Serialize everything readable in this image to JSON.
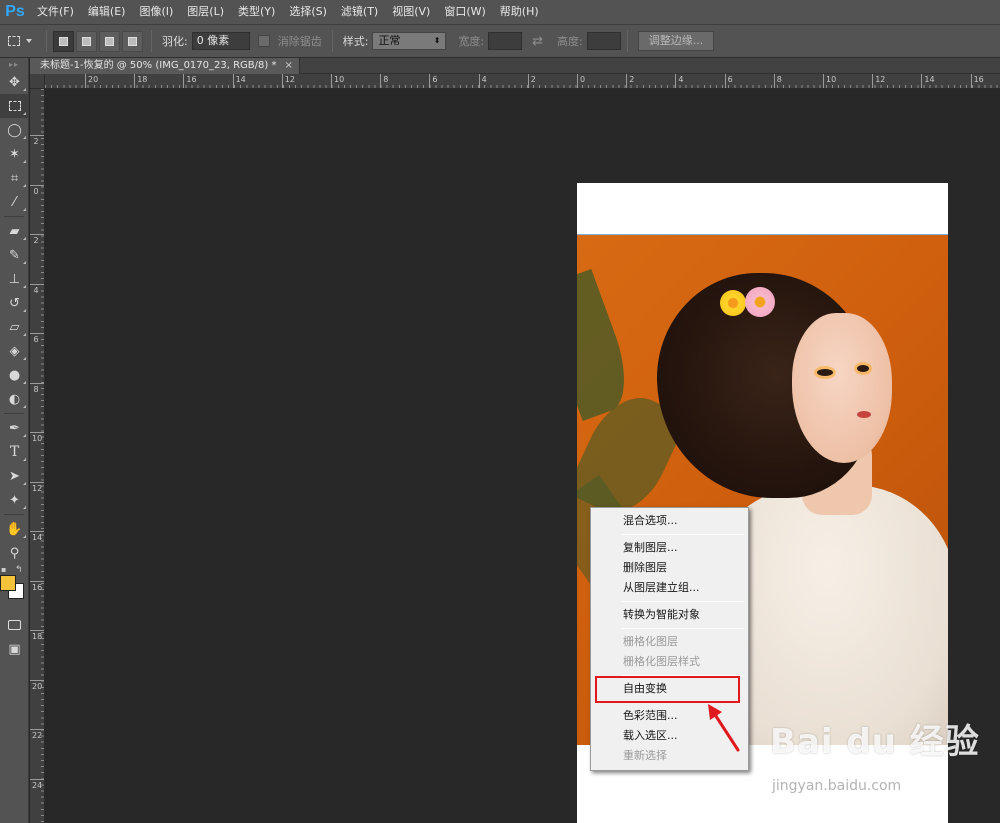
{
  "app": {
    "logo": "Ps"
  },
  "menu": [
    "文件(F)",
    "编辑(E)",
    "图像(I)",
    "图层(L)",
    "类型(Y)",
    "选择(S)",
    "滤镜(T)",
    "视图(V)",
    "窗口(W)",
    "帮助(H)"
  ],
  "options": {
    "feather_label": "羽化:",
    "feather_value": "0 像素",
    "antialias_label": "消除锯齿",
    "style_label": "样式:",
    "style_value": "正常",
    "width_label": "宽度:",
    "height_label": "高度:",
    "refine_button": "调整边缘..."
  },
  "document": {
    "tab_title": "未标题-1-恢复的 @ 50% (IMG_0170_23, RGB/8) *",
    "close": "×"
  },
  "rulers": {
    "horizontal": [
      "20",
      "18",
      "16",
      "14",
      "12",
      "10",
      "8",
      "6",
      "4",
      "2",
      "0",
      "2",
      "4",
      "6",
      "8",
      "10",
      "12",
      "14",
      "16"
    ],
    "vertical": [
      "2",
      "0",
      "2",
      "4",
      "6",
      "8",
      "10",
      "12",
      "14",
      "16",
      "18",
      "20",
      "22",
      "24"
    ]
  },
  "context_menu": [
    {
      "label": "混合选项...",
      "disabled": false
    },
    {
      "sep": true
    },
    {
      "label": "复制图层...",
      "disabled": false
    },
    {
      "label": "删除图层",
      "disabled": false
    },
    {
      "label": "从图层建立组...",
      "disabled": false
    },
    {
      "sep": true
    },
    {
      "label": "转换为智能对象",
      "disabled": false
    },
    {
      "sep": true
    },
    {
      "label": "栅格化图层",
      "disabled": true
    },
    {
      "label": "栅格化图层样式",
      "disabled": true
    },
    {
      "sep": true
    },
    {
      "label": "自由变换",
      "disabled": false
    },
    {
      "sep": true
    },
    {
      "label": "色彩范围...",
      "disabled": false
    },
    {
      "label": "载入选区...",
      "disabled": false
    },
    {
      "label": "重新选择",
      "disabled": true
    }
  ],
  "watermark": {
    "brand": "Bai du 经验",
    "url": "jingyan.baidu.com"
  },
  "colors": {
    "foreground": "#f5c33a",
    "background": "#ffffff",
    "highlight": "#e0191e"
  }
}
